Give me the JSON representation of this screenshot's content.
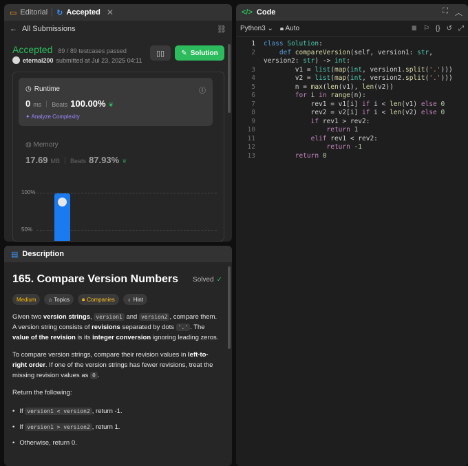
{
  "left_tabs": {
    "editorial": "Editorial",
    "accepted": "Accepted"
  },
  "submission": {
    "back_label": "All Submissions",
    "status": "Accepted",
    "passed": "89 / 89 testcases passed",
    "username": "eternal200",
    "submitted_text": "submitted at Jul 23, 2025 04:11",
    "solution_label": "Solution",
    "runtime_title": "Runtime",
    "runtime_value": "0",
    "runtime_unit": "ms",
    "beats_label": "Beats",
    "runtime_beats": "100.00%",
    "analyze_label": "Analyze Complexity",
    "memory_title": "Memory",
    "memory_value": "17.69",
    "memory_unit": "MB",
    "memory_beats": "87.93%",
    "chart_labels": [
      "100%",
      "50%"
    ]
  },
  "description": {
    "tab_label": "Description",
    "title": "165. Compare Version Numbers",
    "solved": "Solved",
    "chips": {
      "difficulty": "Medium",
      "topics": "Topics",
      "companies": "Companies",
      "hint": "Hint"
    },
    "p1": {
      "t1": "Given two ",
      "b1": "version strings",
      "t2": ", ",
      "c1": "version1",
      "t3": " and ",
      "c2": "version2",
      "t4": ", compare them. A version string consists of ",
      "b2": "revisions",
      "t5": " separated by dots ",
      "c3": "'.'",
      "t6": ". The ",
      "b3": "value of the revision",
      "t7": " is its ",
      "b4": "integer conversion",
      "t8": " ignoring leading zeros."
    },
    "p2": {
      "t1": "To compare version strings, compare their revision values in ",
      "b1": "left-to-right order",
      "t2": ". If one of the version strings has fewer revisions, treat the missing revision values as ",
      "c1": "0",
      "t3": "."
    },
    "p3": "Return the following:",
    "bullets": [
      {
        "pre": "If ",
        "code": "version1 < version2",
        "post": ", return -1."
      },
      {
        "pre": "If ",
        "code": "version1 > version2",
        "post": ", return 1."
      },
      {
        "pre": "Otherwise, return 0.",
        "code": "",
        "post": ""
      }
    ]
  },
  "code_panel": {
    "tab_label": "Code",
    "language": "Python3",
    "mode": "Auto",
    "line_numbers": [
      "1",
      "2",
      "",
      "3",
      "4",
      "5",
      "6",
      "7",
      "8",
      "9",
      "10",
      "11",
      "12",
      "13"
    ]
  },
  "colors": {
    "accent_green": "#2cbb5d",
    "bar_blue": "#1a7aef",
    "medium": "#ffb800"
  },
  "icons": [
    "book-icon",
    "history-icon",
    "arrow-left-icon",
    "link-icon",
    "code-icon",
    "lock-icon",
    "gear-icon"
  ]
}
